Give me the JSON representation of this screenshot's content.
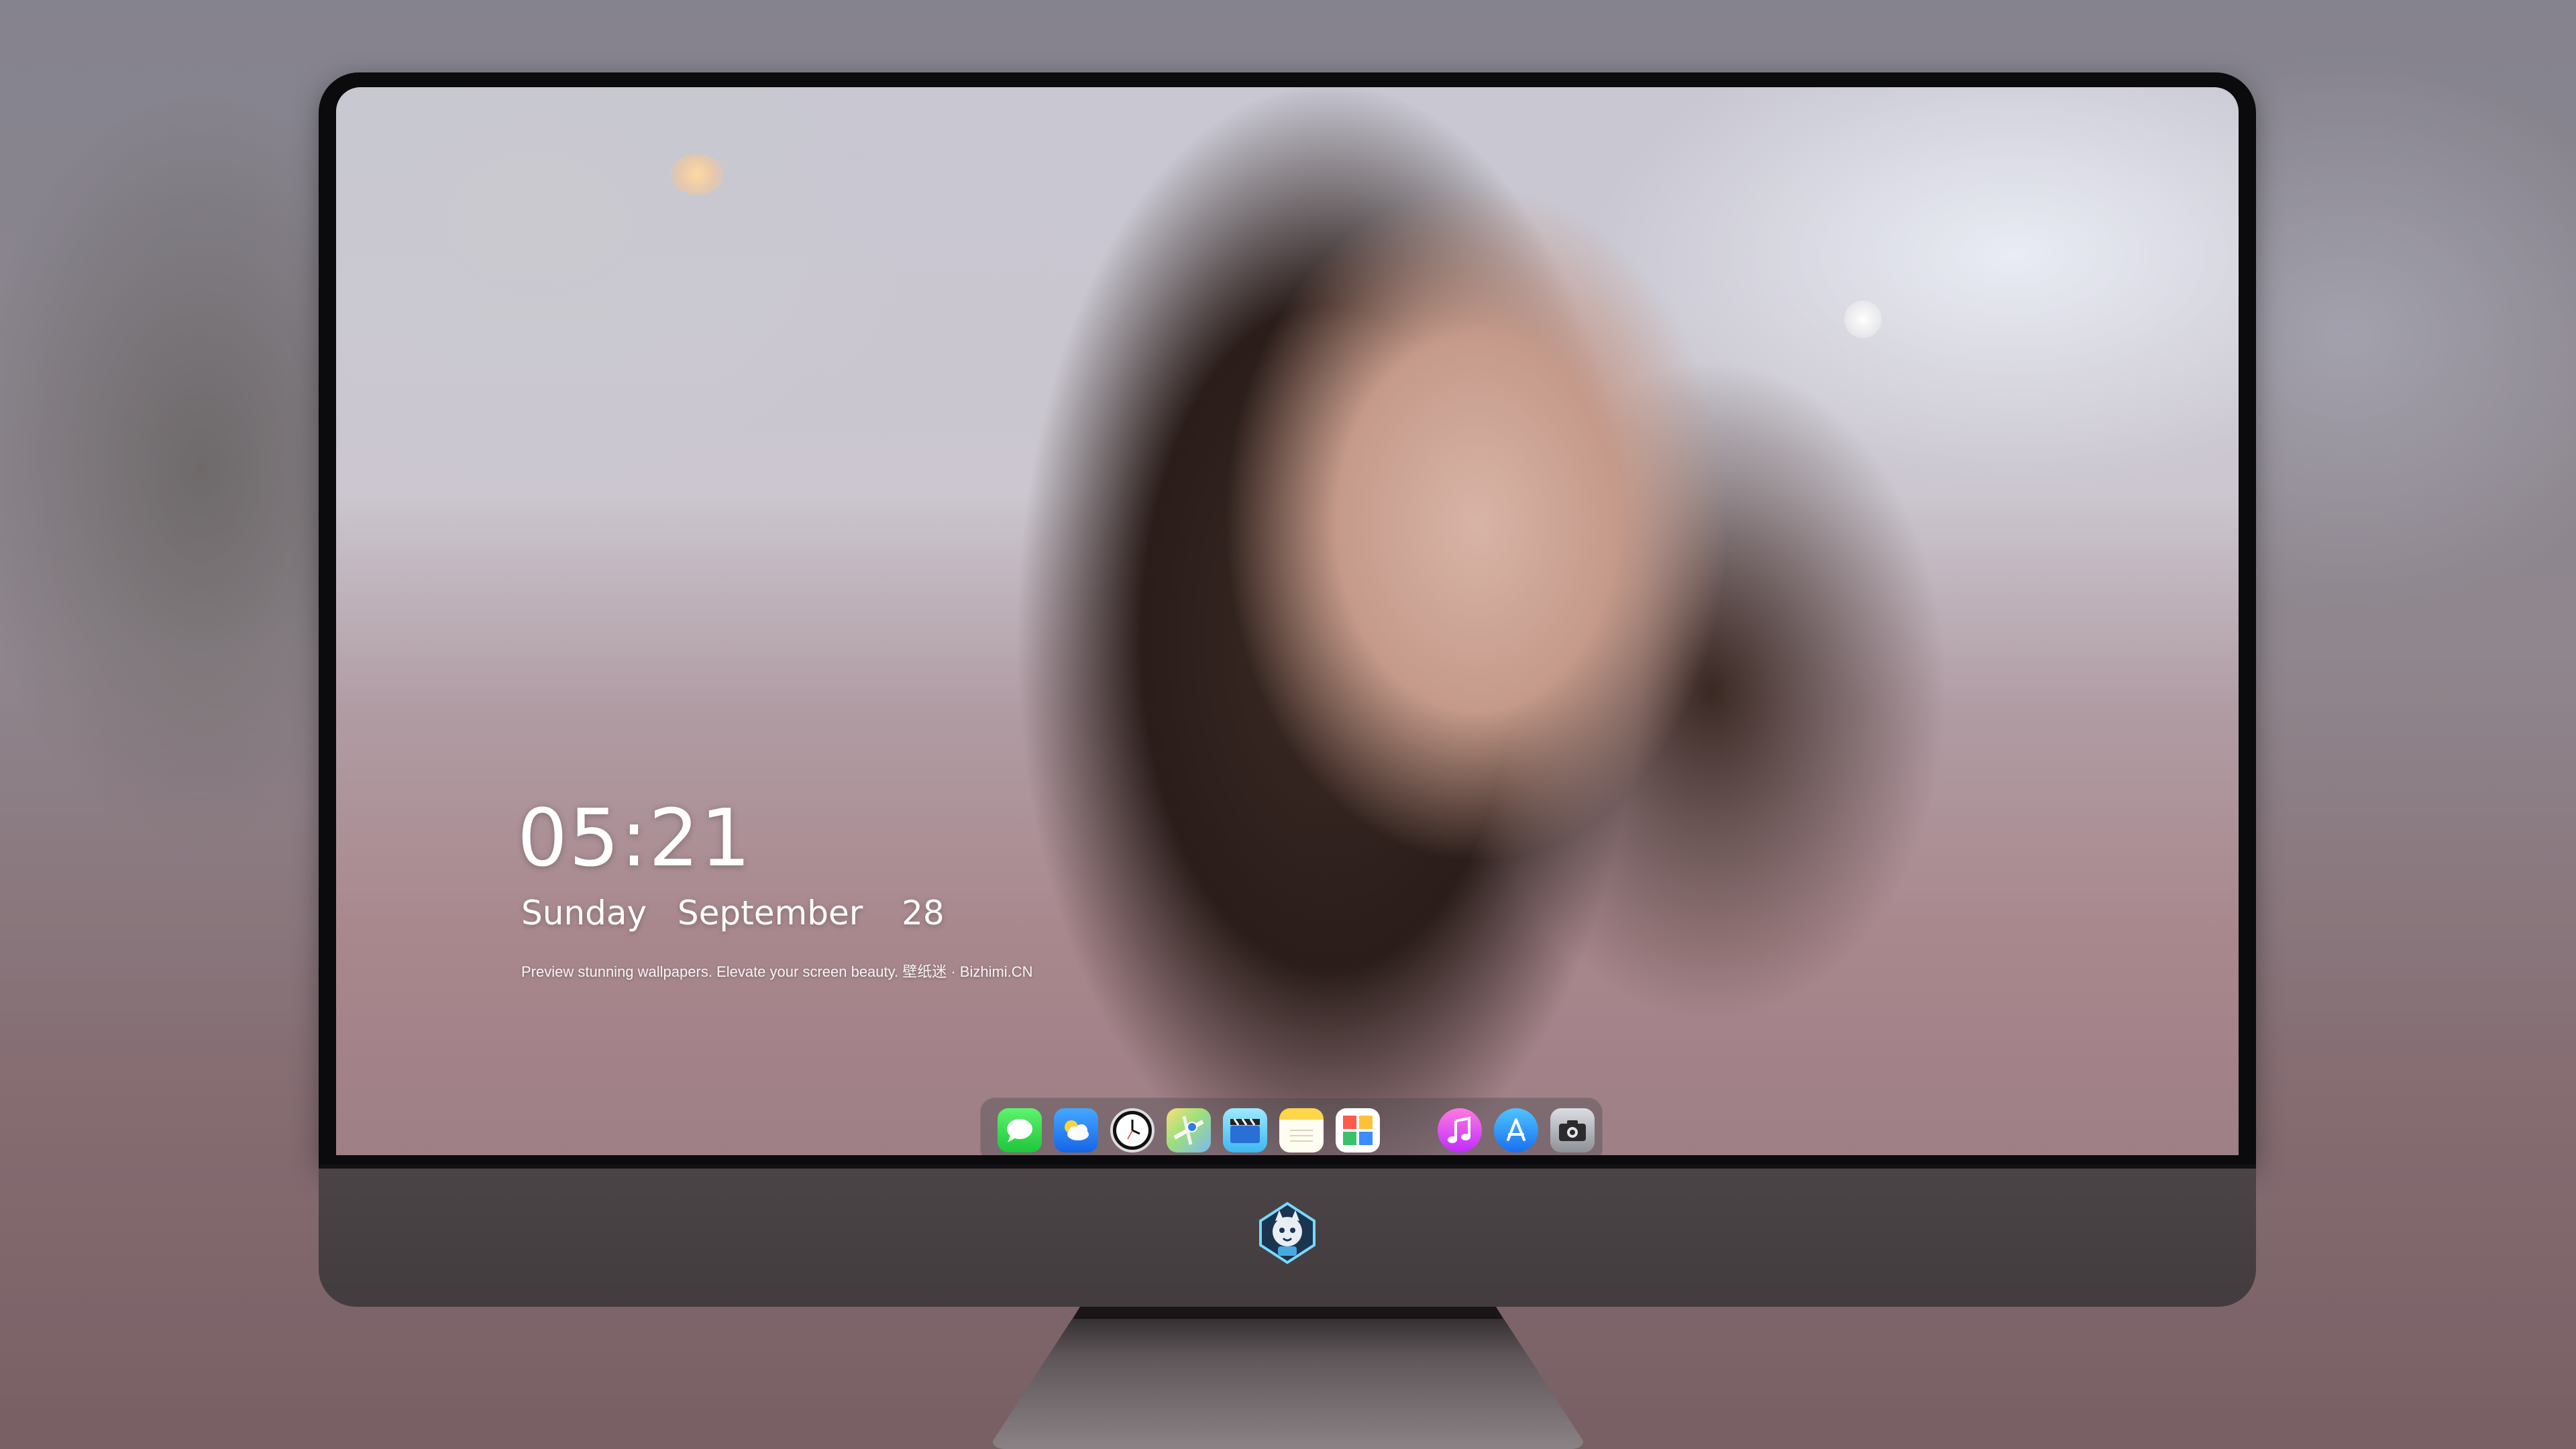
{
  "lock_screen": {
    "time": "05:21",
    "weekday": "Sunday",
    "month": "September",
    "day": "28",
    "tagline": "Preview stunning wallpapers. Elevate your screen beauty. 壁纸迷 · Bizhimi.CN"
  },
  "dock": {
    "items": [
      {
        "name": "messages-icon"
      },
      {
        "name": "weather-icon"
      },
      {
        "name": "clock-icon"
      },
      {
        "name": "maps-icon"
      },
      {
        "name": "video-icon"
      },
      {
        "name": "notes-icon"
      },
      {
        "name": "photos-icon"
      },
      {
        "name": "music-icon"
      },
      {
        "name": "app-store-icon"
      },
      {
        "name": "camera-icon"
      }
    ]
  },
  "monitor": {
    "logo": "wolf-mascot-logo"
  },
  "colors": {
    "bezel": "#0b0b0d",
    "chin": "#4b4447",
    "text": "#ffffff",
    "dock_background": "rgba(70,70,75,0.38)"
  }
}
